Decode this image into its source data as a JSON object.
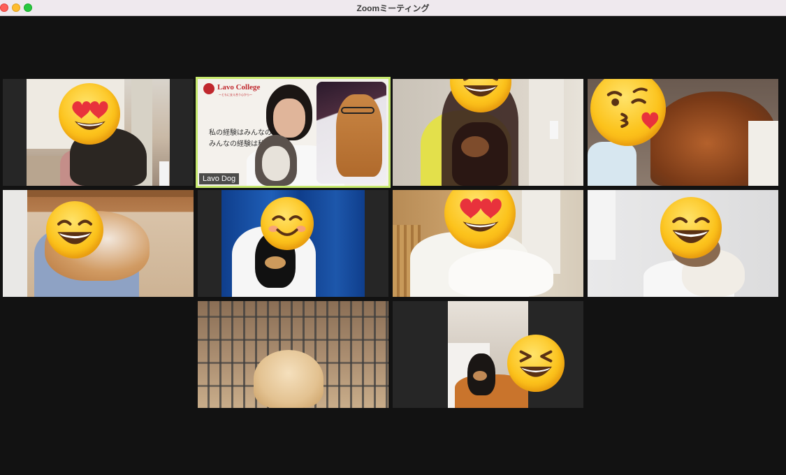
{
  "window": {
    "title": "Zoomミーティング"
  },
  "participants": [
    {
      "id": "p1",
      "emoji": "heart-eyes-emoji"
    },
    {
      "id": "p2",
      "name_label": "Lavo Dog",
      "active_speaker": true
    },
    {
      "id": "p3",
      "emoji": "squinting-laugh-emoji"
    },
    {
      "id": "p4",
      "emoji": "kissing-heart-emoji"
    },
    {
      "id": "p5",
      "emoji": "grinning-smile-emoji"
    },
    {
      "id": "p6",
      "emoji": "smiling-blush-emoji"
    },
    {
      "id": "p7",
      "emoji": "heart-eyes-emoji"
    },
    {
      "id": "p8",
      "emoji": "grinning-smile-emoji"
    },
    {
      "id": "p9"
    },
    {
      "id": "p10",
      "emoji": "squinting-laugh-emoji"
    }
  ],
  "slide": {
    "logo_text": "Lavo College",
    "tagline": "〜ともに支え合う心から〜",
    "line1": "私の経験はみんなの",
    "line2": "みんなの経験は私"
  },
  "colors": {
    "active_speaker_border": "#c5e86c",
    "background": "#121212",
    "titlebar": "#efe9ee"
  }
}
